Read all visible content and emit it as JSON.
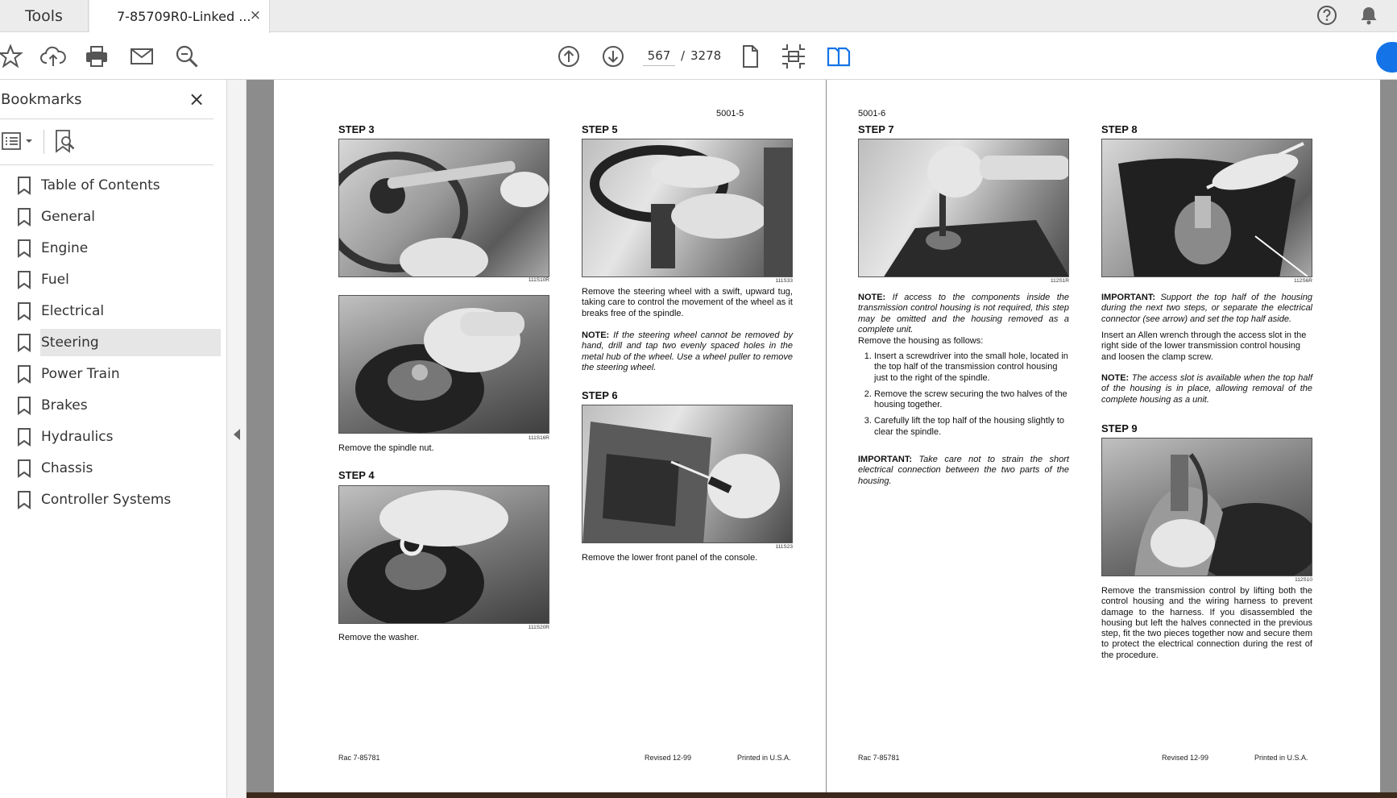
{
  "tabs": {
    "tools_label": "Tools",
    "document_label": "7-85709R0-Linked ...",
    "close_glyph": "×"
  },
  "toolbar": {
    "current_page": "567",
    "page_separator": "/",
    "total_pages": "3278"
  },
  "icons": {
    "header": [
      "help-icon",
      "notification-bell-icon"
    ],
    "toolbar": [
      "bookmark-star-icon",
      "upload-cloud-icon",
      "print-icon",
      "email-icon",
      "zoom-search-icon",
      "previous-page-icon",
      "next-page-icon",
      "single-page-view-icon",
      "fit-page-icon",
      "two-page-view-icon"
    ]
  },
  "sidebar": {
    "title": "Bookmarks",
    "close_glyph": "×",
    "items": [
      {
        "label": "Table of Contents"
      },
      {
        "label": "General"
      },
      {
        "label": "Engine"
      },
      {
        "label": "Fuel"
      },
      {
        "label": "Electrical"
      },
      {
        "label": "Steering",
        "selected": true
      },
      {
        "label": "Power Train"
      },
      {
        "label": "Brakes"
      },
      {
        "label": "Hydraulics"
      },
      {
        "label": "Chassis"
      },
      {
        "label": "Controller Systems"
      }
    ]
  },
  "document": {
    "left_page": {
      "page_number": "5001-5",
      "step3": {
        "title": "STEP  3",
        "fig1": "111S10R",
        "fig2": "111S16R",
        "caption": "Remove the spindle nut."
      },
      "step4": {
        "title": "STEP  4",
        "fig": "111S20R",
        "caption": "Remove the washer."
      },
      "step5": {
        "title": "STEP  5",
        "fig": "111S33",
        "text": "Remove the steering wheel with a swift, upward tug, taking care to control the movement of the wheel as it breaks free of the spindle.",
        "note_label": "NOTE:",
        "note_text": " If the steering wheel cannot be removed by hand, drill and tap two evenly spaced holes in the metal hub of the wheel. Use a wheel puller to remove the steering wheel."
      },
      "step6": {
        "title": "STEP  6",
        "fig": "111S23",
        "caption": "Remove the lower front panel of the console."
      },
      "footer": {
        "left": "Rac 7-85781",
        "revised": "Revised 12-99",
        "printed": "Printed in U.S.A."
      }
    },
    "right_page": {
      "page_number": "5001-6",
      "step7": {
        "title": "STEP  7",
        "fig": "112S1R",
        "note_label": "NOTE:",
        "note_text": " If access to the components inside the transmission control housing is not required, this step may be omitted and the housing removed as a complete unit.",
        "intro": "Remove the housing as follows:",
        "list": [
          "Insert a screwdriver into the small hole, located in the top half of the transmission control housing just to the right of the spindle.",
          "Remove the screw securing the two halves of the housing together.",
          "Carefully lift the top half of the housing slightly to clear the spindle."
        ],
        "important_label": "IMPORTANT:",
        "important_text": " Take care not to strain the short electrical connection between the two parts of the housing."
      },
      "step8": {
        "title": "STEP  8",
        "fig": "112S6R",
        "important_label": "IMPORTANT:",
        "important_text": " Support the top half of the housing during the next two steps, or separate the electrical connector (see arrow) and set the top half aside.",
        "text": "Insert an Allen wrench through the access slot in the right side of the lower transmission control housing and loosen the clamp screw.",
        "note_label": "NOTE:",
        "note_text": " The access slot is available when the top half of the housing is in place, allowing removal of the complete housing as a unit."
      },
      "step9": {
        "title": "STEP  9",
        "fig": "112S10",
        "text": "Remove the transmission control by lifting both the control housing and the wiring harness to prevent damage to the harness. If you disassembled the housing but left the halves connected in the previous step, fit the two pieces together now and secure them to protect the electrical connection during the rest of the procedure."
      },
      "footer": {
        "left": "Rac 7-85781",
        "revised": "Revised 12-99",
        "printed": "Printed in U.S.A."
      }
    }
  }
}
